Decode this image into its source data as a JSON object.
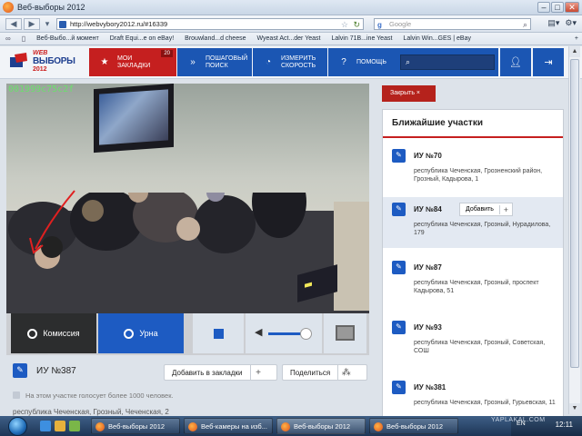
{
  "window": {
    "title": "Веб-выборы 2012"
  },
  "navbar": {
    "url": "http://webvybory2012.ru/#16339",
    "search_placeholder": "Google"
  },
  "bookmarks": [
    "Веб-Выбо...й момент",
    "Draft Equi...e on eBay!",
    "Brouwland...d cheese",
    "Wyeast Act...der Yeast",
    "Lalvin 71B...ine Yeast",
    "Lalvin Win...GES | eBay"
  ],
  "site": {
    "logo_top": "WEB",
    "logo_main": "ВЫБОРЫ",
    "logo_year": "2012",
    "menu": {
      "bookmarks_label": "МОИ ЗАКЛАДКИ",
      "bookmarks_count": "20",
      "search_label": "ПОШАГОВЫЙ ПОИСК",
      "speed_label": "ИЗМЕРИТЬ СКОРОСТЬ",
      "help_label": "ПОМОЩЬ"
    }
  },
  "video": {
    "camera_id": "001999c75c2f",
    "controls": {
      "commission_label": "Комиссия",
      "urn_label": "Урна"
    },
    "volume_level": 0.9
  },
  "station": {
    "name": "ИУ №387",
    "add_bookmark_label": "Добавить в закладки",
    "share_label": "Поделиться",
    "note": "На этом участке голосует более 1000 человек.",
    "address": "республика Чеченская, Грозный, Чеченская, 2"
  },
  "close_video_label": "Закрыть  ×",
  "nearby": {
    "heading": "Ближайшие участки",
    "add_label": "Добавить",
    "items": [
      {
        "name": "ИУ №70",
        "address": "республика Чеченская, Грозненский район, Грозный, Кадырова, 1"
      },
      {
        "name": "ИУ №84",
        "address": "республика Чеченская, Грозный, Нурадилова, 179"
      },
      {
        "name": "ИУ №87",
        "address": "республика Чеченская, Грозный, проспект Кадырова, 51"
      },
      {
        "name": "ИУ №93",
        "address": "республика Чеченская, Грозный, Советская, СОШ"
      },
      {
        "name": "ИУ №381",
        "address": "республика Чеченская, Грозный, Гурьевская, 11"
      }
    ]
  },
  "taskbar": {
    "tasks": [
      "Веб-выборы 2012",
      "Веб-камеры на изб...",
      "Веб-выборы 2012",
      "Веб-выборы 2012"
    ],
    "lang": "EN",
    "clock": "12:11",
    "watermark": "YAPLAKAL.COM"
  },
  "colors": {
    "brand_red": "#c51f1f",
    "brand_blue": "#1b56b3",
    "camera_id_green": "#6be06b"
  },
  "icons": [
    "firefox-icon",
    "back-icon",
    "forward-icon",
    "favicon",
    "star-icon",
    "reload-icon",
    "google-icon",
    "search-icon",
    "page-menu-icon",
    "tools-icon",
    "bookmark-star-icon",
    "eye-icon",
    "stop-icon",
    "speaker-icon",
    "fullscreen-icon",
    "share-icon",
    "ballot-icon",
    "user-icon",
    "logout-icon"
  ]
}
